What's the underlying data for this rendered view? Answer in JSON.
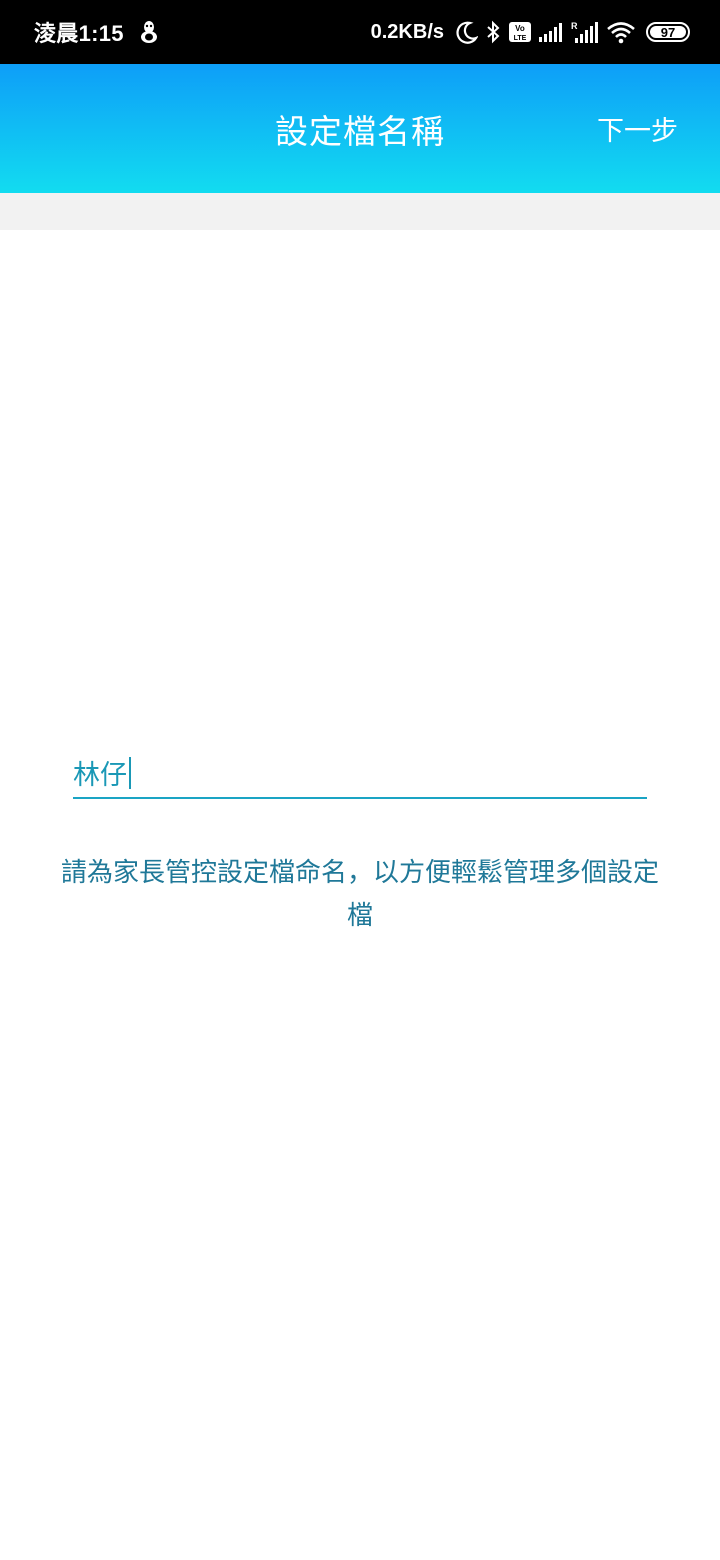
{
  "status_bar": {
    "time": "淩晨1:15",
    "net_speed": "0.2KB/s",
    "battery_level": "97",
    "icons": [
      "notification-bird-icon",
      "moon-icon",
      "bluetooth-icon",
      "volte-icon",
      "signal-icon",
      "roaming-signal-icon",
      "wifi-icon",
      "battery-icon"
    ]
  },
  "app_bar": {
    "title": "設定檔名稱",
    "next_label": "下一步",
    "gradient_start": "#0e9ef8",
    "gradient_end": "#12dcf0"
  },
  "form": {
    "name_value": "林仔",
    "hint": "請為家長管控設定檔命名，以方便輕鬆管理多個設定檔",
    "accent_color": "#1aa4c4"
  }
}
